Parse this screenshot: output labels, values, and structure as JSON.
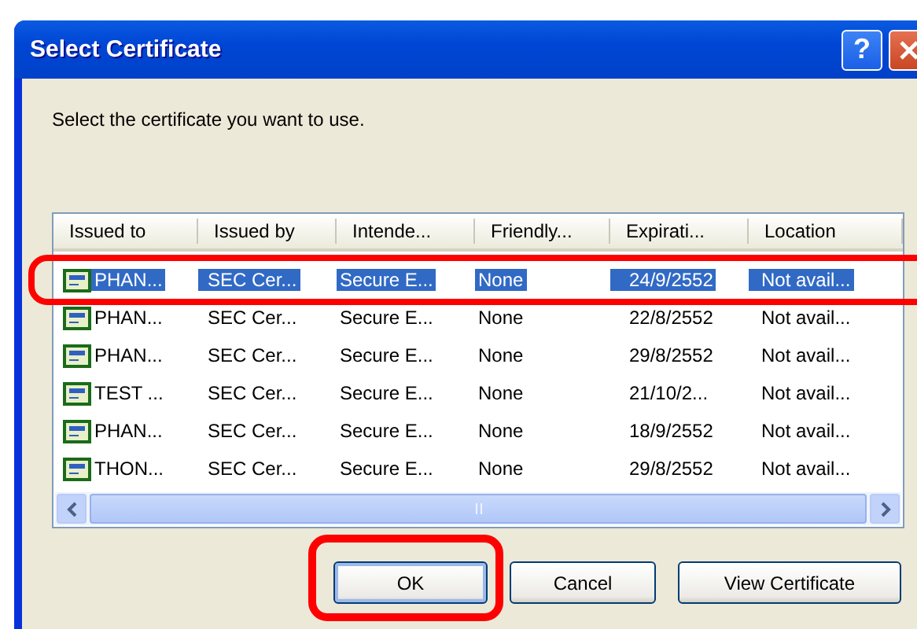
{
  "window": {
    "title": "Select Certificate",
    "help_button": "?"
  },
  "prompt": "Select the certificate you want to use.",
  "table": {
    "columns": [
      "Issued to",
      "Issued by",
      "Intende...",
      "Friendly...",
      "Expirati...",
      "Location"
    ],
    "rows": [
      {
        "selected": true,
        "cells": [
          "PHAN...",
          "SEC Cer...",
          "Secure E...",
          "None",
          "24/9/2552",
          "Not avail..."
        ]
      },
      {
        "selected": false,
        "cells": [
          "PHAN...",
          "SEC Cer...",
          "Secure E...",
          "None",
          "22/8/2552",
          "Not avail..."
        ]
      },
      {
        "selected": false,
        "cells": [
          "PHAN...",
          "SEC Cer...",
          "Secure E...",
          "None",
          "29/8/2552",
          "Not avail..."
        ]
      },
      {
        "selected": false,
        "cells": [
          "TEST ...",
          "SEC Cer...",
          "Secure E...",
          "None",
          "21/10/2...",
          "Not avail..."
        ]
      },
      {
        "selected": false,
        "cells": [
          "PHAN...",
          "SEC Cer...",
          "Secure E...",
          "None",
          "18/9/2552",
          "Not avail..."
        ]
      },
      {
        "selected": false,
        "cells": [
          "THON...",
          "SEC Cer...",
          "Secure E...",
          "None",
          "29/8/2552",
          "Not avail..."
        ]
      }
    ]
  },
  "buttons": [
    {
      "label": "OK",
      "default": true
    },
    {
      "label": "Cancel",
      "default": false
    },
    {
      "label": "View Certificate",
      "default": false
    }
  ]
}
